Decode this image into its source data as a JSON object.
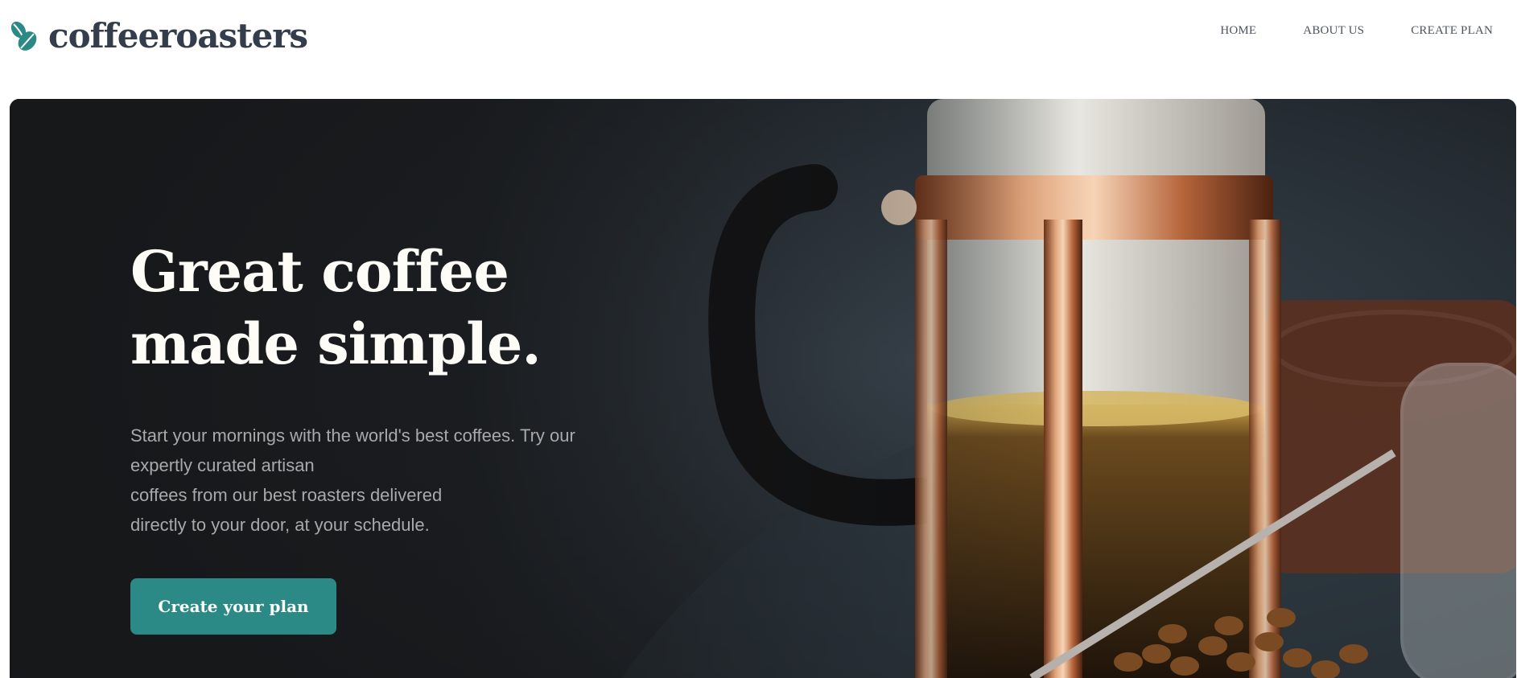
{
  "brand": {
    "name": "coffeeroasters",
    "logo_icon": "coffee-bean-icon",
    "accent_color": "#2b8a86",
    "text_color": "#333d4b"
  },
  "nav": {
    "items": [
      {
        "label": "HOME"
      },
      {
        "label": "ABOUT US"
      },
      {
        "label": "CREATE PLAN"
      }
    ]
  },
  "hero": {
    "title_line1": "Great coffee",
    "title_line2": "made simple.",
    "text_lines": [
      "Start your mornings with the world's best coffees. Try our",
      "expertly curated artisan",
      "coffees from our best roasters delivered",
      "directly to your door, at your schedule."
    ],
    "cta_label": "Create your plan",
    "image": "french-press-coffee-photo"
  }
}
